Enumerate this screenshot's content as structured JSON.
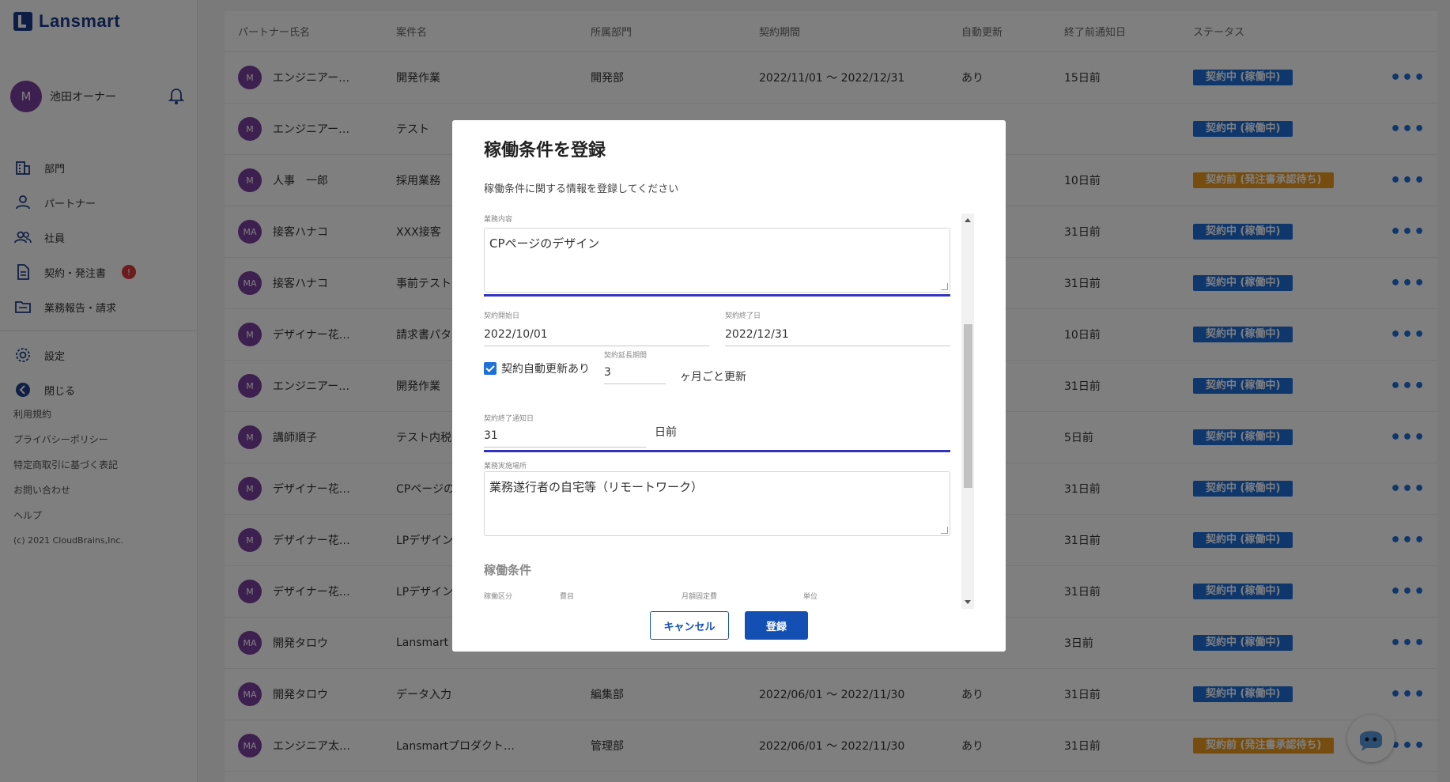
{
  "app": {
    "logo": "Lansmart"
  },
  "user": {
    "initial": "M",
    "name": "池田オーナー"
  },
  "nav": {
    "items": [
      {
        "label": "部門",
        "icon": "building-icon"
      },
      {
        "label": "パートナー",
        "icon": "person-icon"
      },
      {
        "label": "社員",
        "icon": "people-icon"
      },
      {
        "label": "契約・発注書",
        "icon": "document-icon",
        "badge": "!"
      },
      {
        "label": "業務報告・請求",
        "icon": "folder-icon"
      }
    ],
    "settings": "設定",
    "close": "閉じる"
  },
  "footer": {
    "links": [
      "利用規約",
      "プライバシーポリシー",
      "特定商取引に基づく表記",
      "お問い合わせ",
      "ヘルプ"
    ],
    "copyright": "(c) 2021 CloudBrains,Inc."
  },
  "table": {
    "headers": [
      "パートナー氏名",
      "案件名",
      "所属部門",
      "契約期間",
      "自動更新",
      "終了前通知日",
      "ステータス"
    ],
    "rows": [
      {
        "avatar": "M",
        "partner": "エンジニアー…",
        "project": "開発作業",
        "dept": "開発部",
        "period": "2022/11/01 ～ 2022/12/31",
        "auto": "あり",
        "notice": "15日前",
        "status": "契約中 (稼働中)",
        "status_type": "blue"
      },
      {
        "avatar": "M",
        "partner": "エンジニアー…",
        "project": "テスト",
        "dept": "",
        "period": "",
        "auto": "",
        "notice": "",
        "status": "契約中 (稼働中)",
        "status_type": "blue"
      },
      {
        "avatar": "M",
        "partner": "人事　一郎",
        "project": "採用業務",
        "dept": "",
        "period": "",
        "auto": "",
        "notice": "10日前",
        "status": "契約前 (発注書承認待ち)",
        "status_type": "orange"
      },
      {
        "avatar": "MA",
        "partner": "接客ハナコ",
        "project": "XXX接客",
        "dept": "",
        "period": "",
        "auto": "",
        "notice": "31日前",
        "status": "契約中 (稼働中)",
        "status_type": "blue"
      },
      {
        "avatar": "MA",
        "partner": "接客ハナコ",
        "project": "事前テスト",
        "dept": "",
        "period": "",
        "auto": "",
        "notice": "31日前",
        "status": "契約中 (稼働中)",
        "status_type": "blue"
      },
      {
        "avatar": "M",
        "partner": "デザイナー花…",
        "project": "請求書パタ",
        "dept": "",
        "period": "",
        "auto": "",
        "notice": "10日前",
        "status": "契約中 (稼働中)",
        "status_type": "blue"
      },
      {
        "avatar": "M",
        "partner": "エンジニアー…",
        "project": "開発作業",
        "dept": "",
        "period": "",
        "auto": "",
        "notice": "31日前",
        "status": "契約中 (稼働中)",
        "status_type": "blue"
      },
      {
        "avatar": "M",
        "partner": "講師順子",
        "project": "テスト内税",
        "dept": "",
        "period": "",
        "auto": "",
        "notice": "5日前",
        "status": "契約中 (稼働中)",
        "status_type": "blue"
      },
      {
        "avatar": "M",
        "partner": "デザイナー花…",
        "project": "CPページの",
        "dept": "",
        "period": "",
        "auto": "",
        "notice": "31日前",
        "status": "契約中 (稼働中)",
        "status_type": "blue"
      },
      {
        "avatar": "M",
        "partner": "デザイナー花…",
        "project": "LPデザイン",
        "dept": "",
        "period": "",
        "auto": "",
        "notice": "31日前",
        "status": "契約中 (稼働中)",
        "status_type": "blue"
      },
      {
        "avatar": "M",
        "partner": "デザイナー花…",
        "project": "LPデザイン",
        "dept": "",
        "period": "",
        "auto": "",
        "notice": "31日前",
        "status": "契約中 (稼働中)",
        "status_type": "blue"
      },
      {
        "avatar": "MA",
        "partner": "開発タロウ",
        "project": "Lansmart",
        "dept": "",
        "period": "",
        "auto": "",
        "notice": "3日前",
        "status": "契約中 (稼働中)",
        "status_type": "blue"
      },
      {
        "avatar": "MA",
        "partner": "開発タロウ",
        "project": "データ入力",
        "dept": "編集部",
        "period": "2022/06/01 ～ 2022/11/30",
        "auto": "あり",
        "notice": "31日前",
        "status": "契約中 (稼働中)",
        "status_type": "blue"
      },
      {
        "avatar": "MA",
        "partner": "エンジニア太…",
        "project": "Lansmartプロダクト…",
        "dept": "管理部",
        "period": "2022/06/01 ～ 2022/11/30",
        "auto": "あり",
        "notice": "31日前",
        "status": "契約前 (発注書承認待ち)",
        "status_type": "orange"
      }
    ],
    "more_icon": "•••"
  },
  "modal": {
    "title": "稼働条件を登録",
    "subtitle": "稼働条件に関する情報を登録してください",
    "work_content_label": "業務内容",
    "work_content_value": "CPページのデザイン",
    "start_label": "契約開始日",
    "start_value": "2022/10/01",
    "end_label": "契約終了日",
    "end_value": "2022/12/31",
    "auto_renew_label": "契約自動更新あり",
    "extension_label": "契約延長期間",
    "extension_value": "3",
    "extension_unit": "ヶ月ごと更新",
    "notice_label": "契約終了通知日",
    "notice_value": "31",
    "notice_unit": "日前",
    "location_label": "業務実施場所",
    "location_value": "業務遂行者の自宅等（リモートワーク）",
    "conditions_title": "稼働条件",
    "cond_cols": [
      "稼働区分",
      "費目",
      "月額固定費",
      "単位"
    ],
    "cancel": "キャンセル",
    "submit": "登録"
  },
  "colors": {
    "primary": "#1450b4",
    "status_blue": "#1f6fd9",
    "status_orange": "#ef9a1f",
    "avatar": "#7b3fa0",
    "highlight": "#3333c0"
  }
}
